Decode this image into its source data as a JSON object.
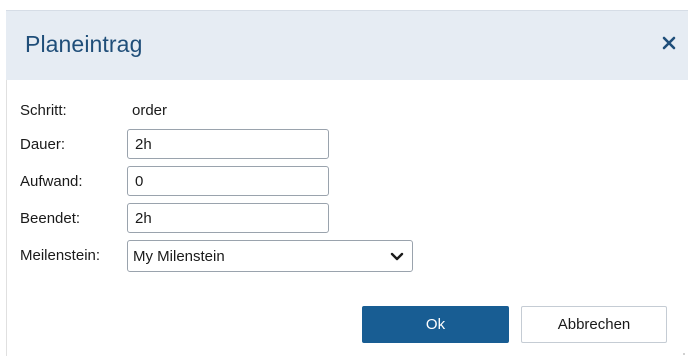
{
  "dialog": {
    "title": "Planeintrag",
    "close_icon": "close-icon"
  },
  "form": {
    "schritt": {
      "label": "Schritt:",
      "value": "order"
    },
    "dauer": {
      "label": "Dauer:",
      "value": "2h"
    },
    "aufwand": {
      "label": "Aufwand:",
      "value": "0"
    },
    "beendet": {
      "label": "Beendet:",
      "value": "2h"
    },
    "meilenstein": {
      "label": "Meilenstein:",
      "selected": "My Milenstein",
      "icon": "chevron-down-icon"
    }
  },
  "buttons": {
    "ok_label": "Ok",
    "cancel_label": "Abbrechen"
  },
  "colors": {
    "title": "#1f4e79",
    "titlebar_bg": "#e6ecf3",
    "primary": "#185d93"
  }
}
